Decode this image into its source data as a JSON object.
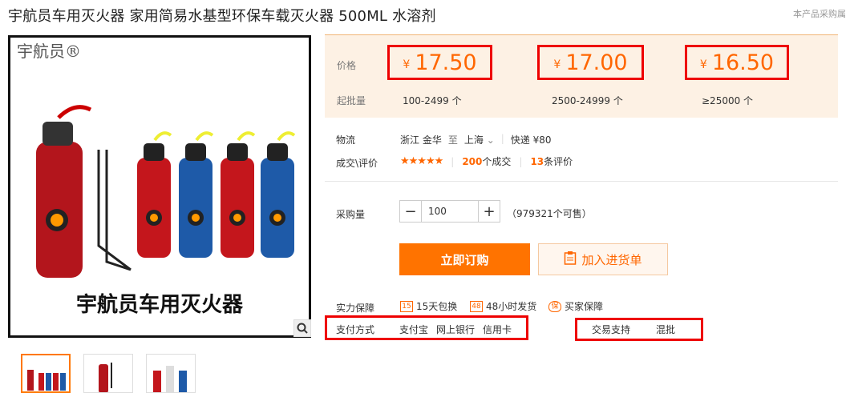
{
  "title": "宇航员车用灭火器 家用简易水基型环保车载灭火器 500ML 水溶剂",
  "note": "本产品采购属",
  "image": {
    "brand": "宇航员®",
    "caption": "宇航员车用灭火器"
  },
  "price": {
    "label": "价格",
    "currency": "¥",
    "tiers": [
      {
        "price": "17.50",
        "range": "100-2499 个"
      },
      {
        "price": "17.00",
        "range": "2500-24999 个"
      },
      {
        "price": "16.50",
        "range": "≥25000 个"
      }
    ],
    "qty_label": "起批量"
  },
  "logistics": {
    "label": "物流",
    "from": "浙江 金华",
    "to_word": "至",
    "to": "上海",
    "express": "快递 ¥80"
  },
  "deals": {
    "label": "成交\\评价",
    "stars": "★★★★★",
    "deals_count": "200",
    "deals_text": "个成交",
    "reviews_count": "13",
    "reviews_text": "条评价"
  },
  "purchase": {
    "label": "采购量",
    "value": "100",
    "minus": "−",
    "plus": "+",
    "available": "（979321个可售）"
  },
  "buttons": {
    "order": "立即订购",
    "cart": "加入进货单"
  },
  "guarantee": {
    "label": "实力保障",
    "items": [
      {
        "icon": "15",
        "text": "15天包换"
      },
      {
        "icon": "48",
        "text": "48小时发货"
      },
      {
        "icon": "保",
        "text": "买家保障"
      }
    ]
  },
  "payment": {
    "label": "支付方式",
    "methods": [
      "支付宝",
      "网上银行",
      "信用卡"
    ]
  },
  "trade": {
    "label": "交易支持",
    "value": "混批"
  },
  "colors": {
    "accent": "#ff7300",
    "highlight": "#ee0000"
  }
}
